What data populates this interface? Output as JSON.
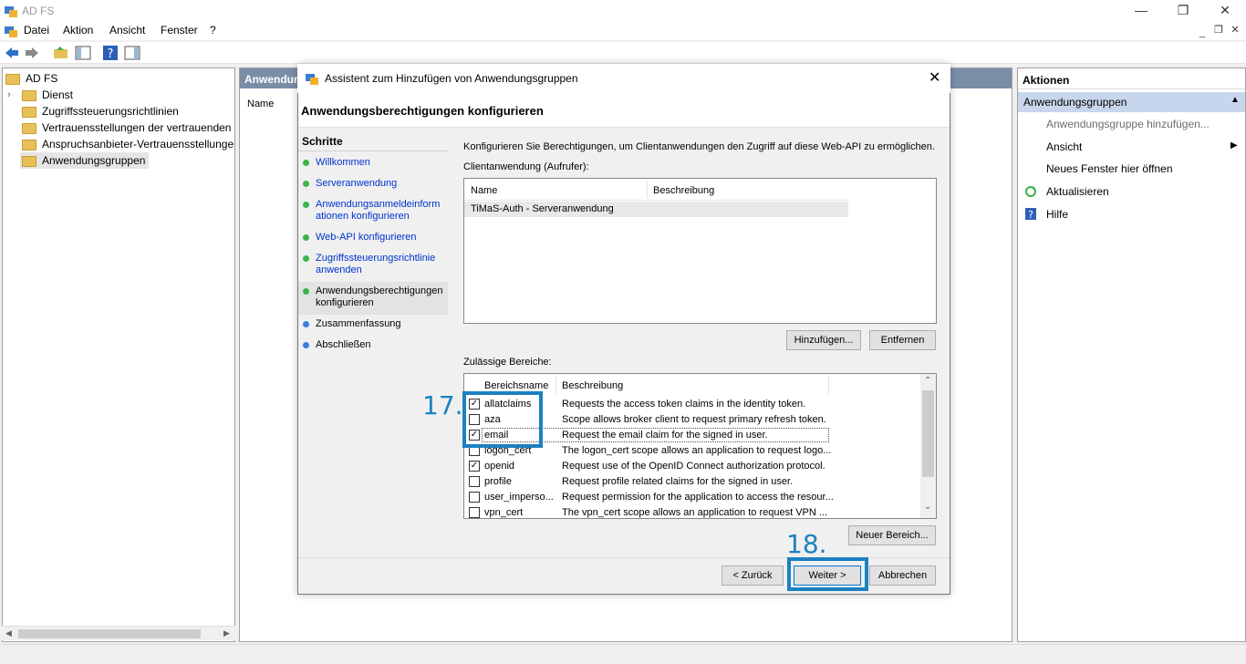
{
  "app": {
    "title": "AD FS"
  },
  "menu": [
    "Datei",
    "Aktion",
    "Ansicht",
    "Fenster",
    "?"
  ],
  "tree": {
    "items": [
      "AD FS",
      "Dienst",
      "Zugriffssteuerungsrichtlinien",
      "Vertrauensstellungen der vertrauenden S",
      "Anspruchsanbieter-Vertrauensstellunger",
      "Anwendungsgruppen"
    ]
  },
  "center": {
    "header": "Anwendung",
    "column": "Name"
  },
  "actions": {
    "title": "Aktionen",
    "group": "Anwendungsgruppen",
    "items": [
      "Anwendungsgruppe hinzufügen...",
      "Ansicht",
      "Neues Fenster hier öffnen",
      "Aktualisieren",
      "Hilfe"
    ]
  },
  "dialog": {
    "title": "Assistent zum Hinzufügen von Anwendungsgruppen",
    "heading": "Anwendungsberechtigungen konfigurieren",
    "steps_title": "Schritte",
    "steps": [
      {
        "label": "Willkommen",
        "state": "done"
      },
      {
        "label": "Serveranwendung",
        "state": "done"
      },
      {
        "label": "Anwendungsanmeldeinformationen konfigurieren",
        "state": "done"
      },
      {
        "label": "Web-API konfigurieren",
        "state": "done"
      },
      {
        "label": "Zugriffssteuerungsrichtlinie anwenden",
        "state": "done"
      },
      {
        "label": "Anwendungsberechtigungen konfigurieren",
        "state": "current"
      },
      {
        "label": "Zusammenfassung",
        "state": "pending"
      },
      {
        "label": "Abschließen",
        "state": "pending"
      }
    ],
    "description": "Konfigurieren Sie Berechtigungen, um Clientanwendungen den Zugriff auf diese Web-API zu ermöglichen.",
    "client_label": "Clientanwendung (Aufrufer):",
    "client_columns": [
      "Name",
      "Beschreibung"
    ],
    "client_rows": [
      {
        "name": "TiMaS-Auth - Serveranwendung",
        "desc": ""
      }
    ],
    "add_button": "Hinzufügen...",
    "remove_button": "Entfernen",
    "scopes_label": "Zulässige Bereiche:",
    "scope_columns": [
      "Bereichsname",
      "Beschreibung"
    ],
    "scopes": [
      {
        "name": "allatclaims",
        "desc": "Requests the access token claims in the identity token.",
        "checked": true
      },
      {
        "name": "aza",
        "desc": "Scope allows broker client to request primary refresh token.",
        "checked": false
      },
      {
        "name": "email",
        "desc": "Request the email claim for the signed in user.",
        "checked": true
      },
      {
        "name": "logon_cert",
        "desc": "The logon_cert scope allows an application to request logo...",
        "checked": false
      },
      {
        "name": "openid",
        "desc": "Request use of the OpenID Connect authorization protocol.",
        "checked": true
      },
      {
        "name": "profile",
        "desc": "Request profile related claims for the signed in user.",
        "checked": false
      },
      {
        "name": "user_imperso...",
        "desc": "Request permission for the application to access the resour...",
        "checked": false
      },
      {
        "name": "vpn_cert",
        "desc": "The vpn_cert scope allows an application to request VPN ...",
        "checked": false
      }
    ],
    "new_scope_button": "Neuer Bereich...",
    "back_button": "< Zurück",
    "next_button": "Weiter >",
    "cancel_button": "Abbrechen"
  },
  "annotations": {
    "step17": "17.",
    "step18": "18."
  },
  "colors": {
    "accent": "#1b81c1",
    "link": "#0033cc"
  }
}
